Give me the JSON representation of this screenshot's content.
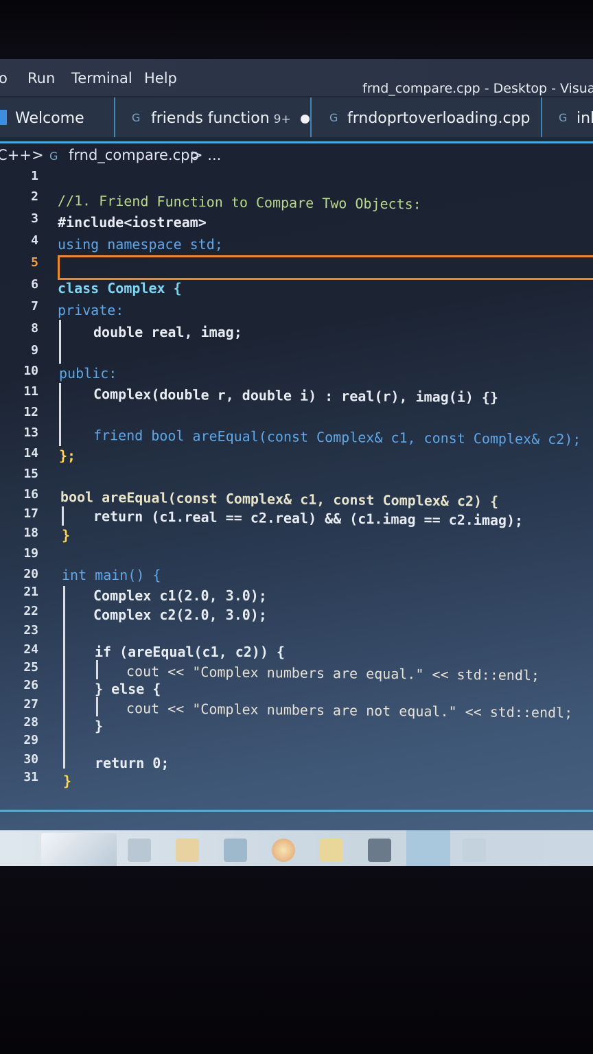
{
  "menu": {
    "items": [
      "o",
      "Run",
      "Terminal",
      "Help"
    ],
    "window_title": "frnd_compare.cpp - Desktop - Visual S"
  },
  "tabs": [
    {
      "label": "Welcome"
    },
    {
      "label": "friends function",
      "badge": "9+"
    },
    {
      "label": "frndoprtoverloading.cpp"
    },
    {
      "label": "inl"
    }
  ],
  "breadcrumb": {
    "lang": "C++",
    "sep": ">",
    "file": "frnd_compare.cpp",
    "rest": "> ..."
  },
  "code_lines": [
    "",
    "//1. Friend Function to Compare Two Objects:",
    "#include<iostream>",
    "using namespace std;",
    "",
    "class Complex {",
    "private:",
    "double real, imag;",
    "",
    "public:",
    "Complex(double r, double i) : real(r), imag(i) {}",
    "",
    "friend bool areEqual(const Complex& c1, const Complex& c2);",
    "};",
    "",
    "bool areEqual(const Complex& c1, const Complex& c2) {",
    "return (c1.real == c2.real) && (c1.imag == c2.imag);",
    "}",
    "",
    "int main() {",
    "Complex c1(2.0, 3.0);",
    "Complex c2(2.0, 3.0);",
    "",
    "if (areEqual(c1, c2)) {",
    "cout << \"Complex numbers are equal.\" << std::endl;",
    "} else {",
    "cout << \"Complex numbers are not equal.\" << std::endl;",
    "}",
    "",
    "return 0;",
    "}"
  ],
  "line_numbers": [
    "1",
    "2",
    "3",
    "4",
    "5",
    "6",
    "7",
    "8",
    "9",
    "10",
    "11",
    "12",
    "13",
    "14",
    "15",
    "16",
    "17",
    "18",
    "19",
    "20",
    "21",
    "22",
    "23",
    "24",
    "25",
    "26",
    "27",
    "28",
    "29",
    "30",
    "31"
  ],
  "current_line": "5",
  "taskbar": {
    "icons": [
      "task-view-icon",
      "store-icon",
      "edge-icon",
      "chrome-icon",
      "file-explorer-icon",
      "photos-icon",
      "vscode-icon",
      "app-icon"
    ]
  }
}
